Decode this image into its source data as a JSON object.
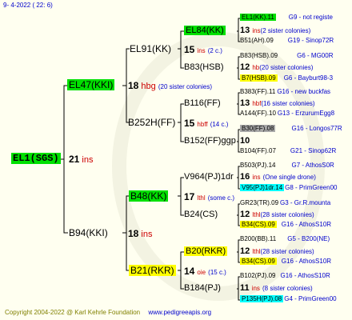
{
  "header": {
    "date": "9-  4-2022 ( 22:  6)"
  },
  "footer": {
    "copyright": "Copyright 2004-2022 @ Karl Kehrle Foundation",
    "website": "www.pedigreeapis.org"
  },
  "root": {
    "id": "EL1(SGS)",
    "num": "21",
    "ins": "ins"
  },
  "gen1": [
    {
      "id": "EL47(KKI)",
      "num": "18",
      "note": "hbg",
      "sisters": "(20 sister colonies)"
    },
    {
      "id": "B94(KKI)",
      "num": "18",
      "note": "ins"
    }
  ],
  "gen2": [
    {
      "id": "EL91(KK)",
      "num": "15",
      "note": "ins",
      "sisters": "(2 c.)"
    },
    {
      "id": "B252H(FF)",
      "num": "15",
      "note": "hbff",
      "sisters": "(14 c.)"
    },
    {
      "id": "B48(KK)",
      "num": "17",
      "note": "lthl",
      "sisters": "(some c.)"
    },
    {
      "id": "B21(RKR)",
      "num": "14",
      "note": "oie",
      "sisters": "(15 c.)"
    }
  ],
  "gen3": [
    {
      "id": "EL84(KK)",
      "num": "13",
      "note": "ins",
      "sisters": "(2 sister colonies)"
    },
    {
      "id": "B83(HSB)",
      "num": "12",
      "note": "hb",
      "sisters": "(20 sister colonies)"
    },
    {
      "id": "B116(FF)",
      "num": "13",
      "note": "hbf",
      "sisters": "(16 sister colonies)"
    },
    {
      "id": "B152(FF)ggp",
      "num": "10",
      "note": "",
      "sisters": ""
    },
    {
      "id": "V964(PJ)1dr",
      "num": "16",
      "note": "ins",
      "sisters": "(One single drone)"
    },
    {
      "id": "B24(CS)",
      "num": "12",
      "note": "lthl",
      "sisters": "(28 sister colonies)"
    },
    {
      "id": "B20(RKR)",
      "num": "12",
      "note": "lthl",
      "sisters": "(28 sister colonies)"
    },
    {
      "id": "B184(PJ)",
      "num": "11",
      "note": "ins",
      "sisters": "(8 sister colonies)"
    }
  ],
  "gen4": [
    {
      "id": "EL1(KK).11",
      "place": "G9 - not registe"
    },
    {
      "id": "B51(AH).09",
      "place": "G19 - Sinop72R"
    },
    {
      "id": "B83(HSB).09",
      "place": "G6 - MG00R"
    },
    {
      "id": "B7(HSB).09",
      "place": "G6 - Bayburt98-3"
    },
    {
      "id": "B383(FF).11",
      "place": "G16 - new buckfas"
    },
    {
      "id": "A144(FF).10",
      "place": "G13 - ErzurumEgg8"
    },
    {
      "id": "B30(FF).08",
      "place": "G16 - Longos77R"
    },
    {
      "id": "B104(FF).07",
      "place": "G21 - Sinop62R"
    },
    {
      "id": "B503(PJ).14",
      "place": "G7 - AthosS0R"
    },
    {
      "id": "V95(PJ)1dr.14",
      "place": "G8 - PrimGreen00"
    },
    {
      "id": "GR23(TR).09",
      "place": "G3 - Gr.R.mounta"
    },
    {
      "id": "B34(CS).09",
      "place": "G16 - AthosS10R"
    },
    {
      "id": "B200(BB).11",
      "place": "G5 - B200(NE)"
    },
    {
      "id": "B34(CS).09",
      "place": "G16 - AthosS10R"
    },
    {
      "id": "B102(PJ).09",
      "place": "G16 - AthosS10R"
    },
    {
      "id": "P135H(PJ).08",
      "place": "G4 - PrimGreen00"
    }
  ],
  "colors": {
    "green": "#00e000",
    "yellow": "#ffff00",
    "gray": "#a8a8a8",
    "cyan": "#00ffff",
    "blue": "#0000cc",
    "red": "#cc0000"
  }
}
